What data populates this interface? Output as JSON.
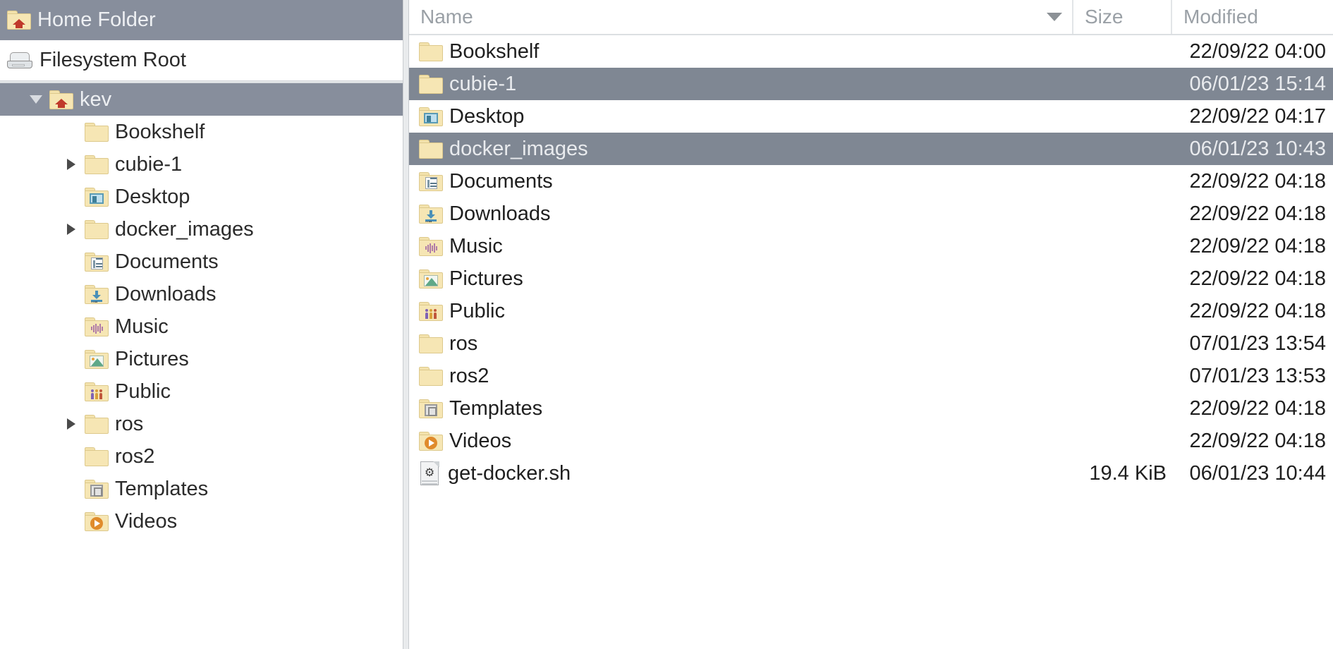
{
  "sidebar": {
    "shortcuts": [
      {
        "label": "Home Folder",
        "icon": "home-folder-icon",
        "selected": true
      },
      {
        "label": "Filesystem Root",
        "icon": "drive-icon",
        "selected": false
      }
    ],
    "tree": [
      {
        "label": "kev",
        "icon": "home-folder-icon",
        "expander": "down",
        "indent": 70,
        "selected": true
      },
      {
        "label": "Bookshelf",
        "icon": "folder-icon",
        "expander": "none",
        "indent": 120,
        "selected": false
      },
      {
        "label": "cubie-1",
        "icon": "folder-icon",
        "expander": "right",
        "indent": 120,
        "selected": false
      },
      {
        "label": "Desktop",
        "icon": "desktop-folder-icon",
        "expander": "none",
        "indent": 120,
        "selected": false
      },
      {
        "label": "docker_images",
        "icon": "folder-icon",
        "expander": "right",
        "indent": 120,
        "selected": false
      },
      {
        "label": "Documents",
        "icon": "documents-folder-icon",
        "expander": "none",
        "indent": 120,
        "selected": false
      },
      {
        "label": "Downloads",
        "icon": "downloads-folder-icon",
        "expander": "none",
        "indent": 120,
        "selected": false
      },
      {
        "label": "Music",
        "icon": "music-folder-icon",
        "expander": "none",
        "indent": 120,
        "selected": false
      },
      {
        "label": "Pictures",
        "icon": "pictures-folder-icon",
        "expander": "none",
        "indent": 120,
        "selected": false
      },
      {
        "label": "Public",
        "icon": "public-folder-icon",
        "expander": "none",
        "indent": 120,
        "selected": false
      },
      {
        "label": "ros",
        "icon": "folder-icon",
        "expander": "right",
        "indent": 120,
        "selected": false
      },
      {
        "label": "ros2",
        "icon": "folder-icon",
        "expander": "none",
        "indent": 120,
        "selected": false
      },
      {
        "label": "Templates",
        "icon": "templates-folder-icon",
        "expander": "none",
        "indent": 120,
        "selected": false
      },
      {
        "label": "Videos",
        "icon": "videos-folder-icon",
        "expander": "none",
        "indent": 120,
        "selected": false
      }
    ]
  },
  "filepane": {
    "columns": {
      "name": "Name",
      "size": "Size",
      "modified": "Modified"
    },
    "sort": {
      "column": "Name",
      "direction": "descending",
      "icon": "sort-descending-arrow-icon"
    },
    "rows": [
      {
        "name": "Bookshelf",
        "icon": "folder-icon",
        "size": "",
        "modified": "22/09/22 04:00",
        "selected": false
      },
      {
        "name": "cubie-1",
        "icon": "folder-icon",
        "size": "",
        "modified": "06/01/23 15:14",
        "selected": true
      },
      {
        "name": "Desktop",
        "icon": "desktop-folder-icon",
        "size": "",
        "modified": "22/09/22 04:17",
        "selected": false
      },
      {
        "name": "docker_images",
        "icon": "folder-icon",
        "size": "",
        "modified": "06/01/23 10:43",
        "selected": true
      },
      {
        "name": "Documents",
        "icon": "documents-folder-icon",
        "size": "",
        "modified": "22/09/22 04:18",
        "selected": false
      },
      {
        "name": "Downloads",
        "icon": "downloads-folder-icon",
        "size": "",
        "modified": "22/09/22 04:18",
        "selected": false
      },
      {
        "name": "Music",
        "icon": "music-folder-icon",
        "size": "",
        "modified": "22/09/22 04:18",
        "selected": false
      },
      {
        "name": "Pictures",
        "icon": "pictures-folder-icon",
        "size": "",
        "modified": "22/09/22 04:18",
        "selected": false
      },
      {
        "name": "Public",
        "icon": "public-folder-icon",
        "size": "",
        "modified": "22/09/22 04:18",
        "selected": false
      },
      {
        "name": "ros",
        "icon": "folder-icon",
        "size": "",
        "modified": "07/01/23 13:54",
        "selected": false
      },
      {
        "name": "ros2",
        "icon": "folder-icon",
        "size": "",
        "modified": "07/01/23 13:53",
        "selected": false
      },
      {
        "name": "Templates",
        "icon": "templates-folder-icon",
        "size": "",
        "modified": "22/09/22 04:18",
        "selected": false
      },
      {
        "name": "Videos",
        "icon": "videos-folder-icon",
        "size": "",
        "modified": "22/09/22 04:18",
        "selected": false
      },
      {
        "name": "get-docker.sh",
        "icon": "shell-script-icon",
        "size": "19.4 KiB",
        "modified": "06/01/23 10:44",
        "selected": false
      }
    ]
  },
  "colors": {
    "selection": "#7f8793",
    "header_selection": "#878e9c",
    "folder_fill": "#f6e6b4",
    "folder_border": "#ddc98c",
    "header_text": "#9aa0a6"
  }
}
